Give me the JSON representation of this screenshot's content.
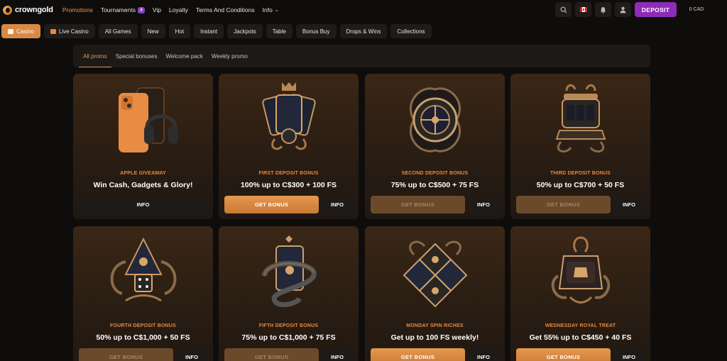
{
  "brand": {
    "name": "crowngold"
  },
  "nav": {
    "links": [
      {
        "label": "Promotions",
        "active": true
      },
      {
        "label": "Tournaments",
        "badge": "4"
      },
      {
        "label": "Vip"
      },
      {
        "label": "Loyalty"
      },
      {
        "label": "Terms And Conditions"
      },
      {
        "label": "Info"
      }
    ],
    "deposit_label": "DEPOSIT",
    "balance": "0 CAD"
  },
  "categories": [
    "Casino",
    "Live Casino",
    "All Games",
    "New",
    "Hot",
    "Instant",
    "Jackpots",
    "Table",
    "Bonus Buy",
    "Drops & Wins",
    "Collections"
  ],
  "promo_tabs": [
    "All promo",
    "Special bonuses",
    "Welcome pack",
    "Weekly promo"
  ],
  "cards": [
    {
      "subtitle": "APPLE GIVEAWAY",
      "title": "Win Cash, Gadgets & Glory!",
      "button": "",
      "info": "INFO",
      "state": "info-only",
      "art": "phone-headphones"
    },
    {
      "subtitle": "FIRST DEPOSIT BONUS",
      "title": "100% up to C$300 + 100 FS",
      "button": "GET BONUS",
      "info": "INFO",
      "state": "active",
      "art": "cards-emblem"
    },
    {
      "subtitle": "SECOND DEPOSIT BONUS",
      "title": "75% up to C$500 + 75 FS",
      "button": "GET BONUS",
      "info": "INFO",
      "state": "disabled",
      "art": "roulette-emblem"
    },
    {
      "subtitle": "THIRD DEPOSIT BONUS",
      "title": "50% up to C$700 + 50 FS",
      "button": "GET BONUS",
      "info": "INFO",
      "state": "disabled",
      "art": "slot-emblem"
    },
    {
      "subtitle": "FOURTH DEPOSIT BONUS",
      "title": "50% up to C$1,000 + 50 FS",
      "button": "GET BONUS",
      "info": "INFO",
      "state": "disabled",
      "art": "dice-emblem"
    },
    {
      "subtitle": "FIFTH DEPOSIT BONUS",
      "title": "75% up to C$1,000 + 75 FS",
      "button": "GET BONUS",
      "info": "INFO",
      "state": "disabled",
      "art": "card-snake-emblem"
    },
    {
      "subtitle": "MONDAY SPIN RICHES",
      "title": "Get up to 100 FS weekly!",
      "button": "GET BONUS",
      "info": "INFO",
      "state": "active",
      "art": "diamond-emblem"
    },
    {
      "subtitle": "WEDNESDAY ROYAL TREAT",
      "title": "Get 55% up to C$450 + 40 FS",
      "button": "GET BONUS",
      "info": "INFO",
      "state": "active",
      "art": "chest-emblem"
    }
  ],
  "colors": {
    "accent": "#e99a52",
    "deposit": "#8e2bb8",
    "badge": "#8a3fc7"
  }
}
